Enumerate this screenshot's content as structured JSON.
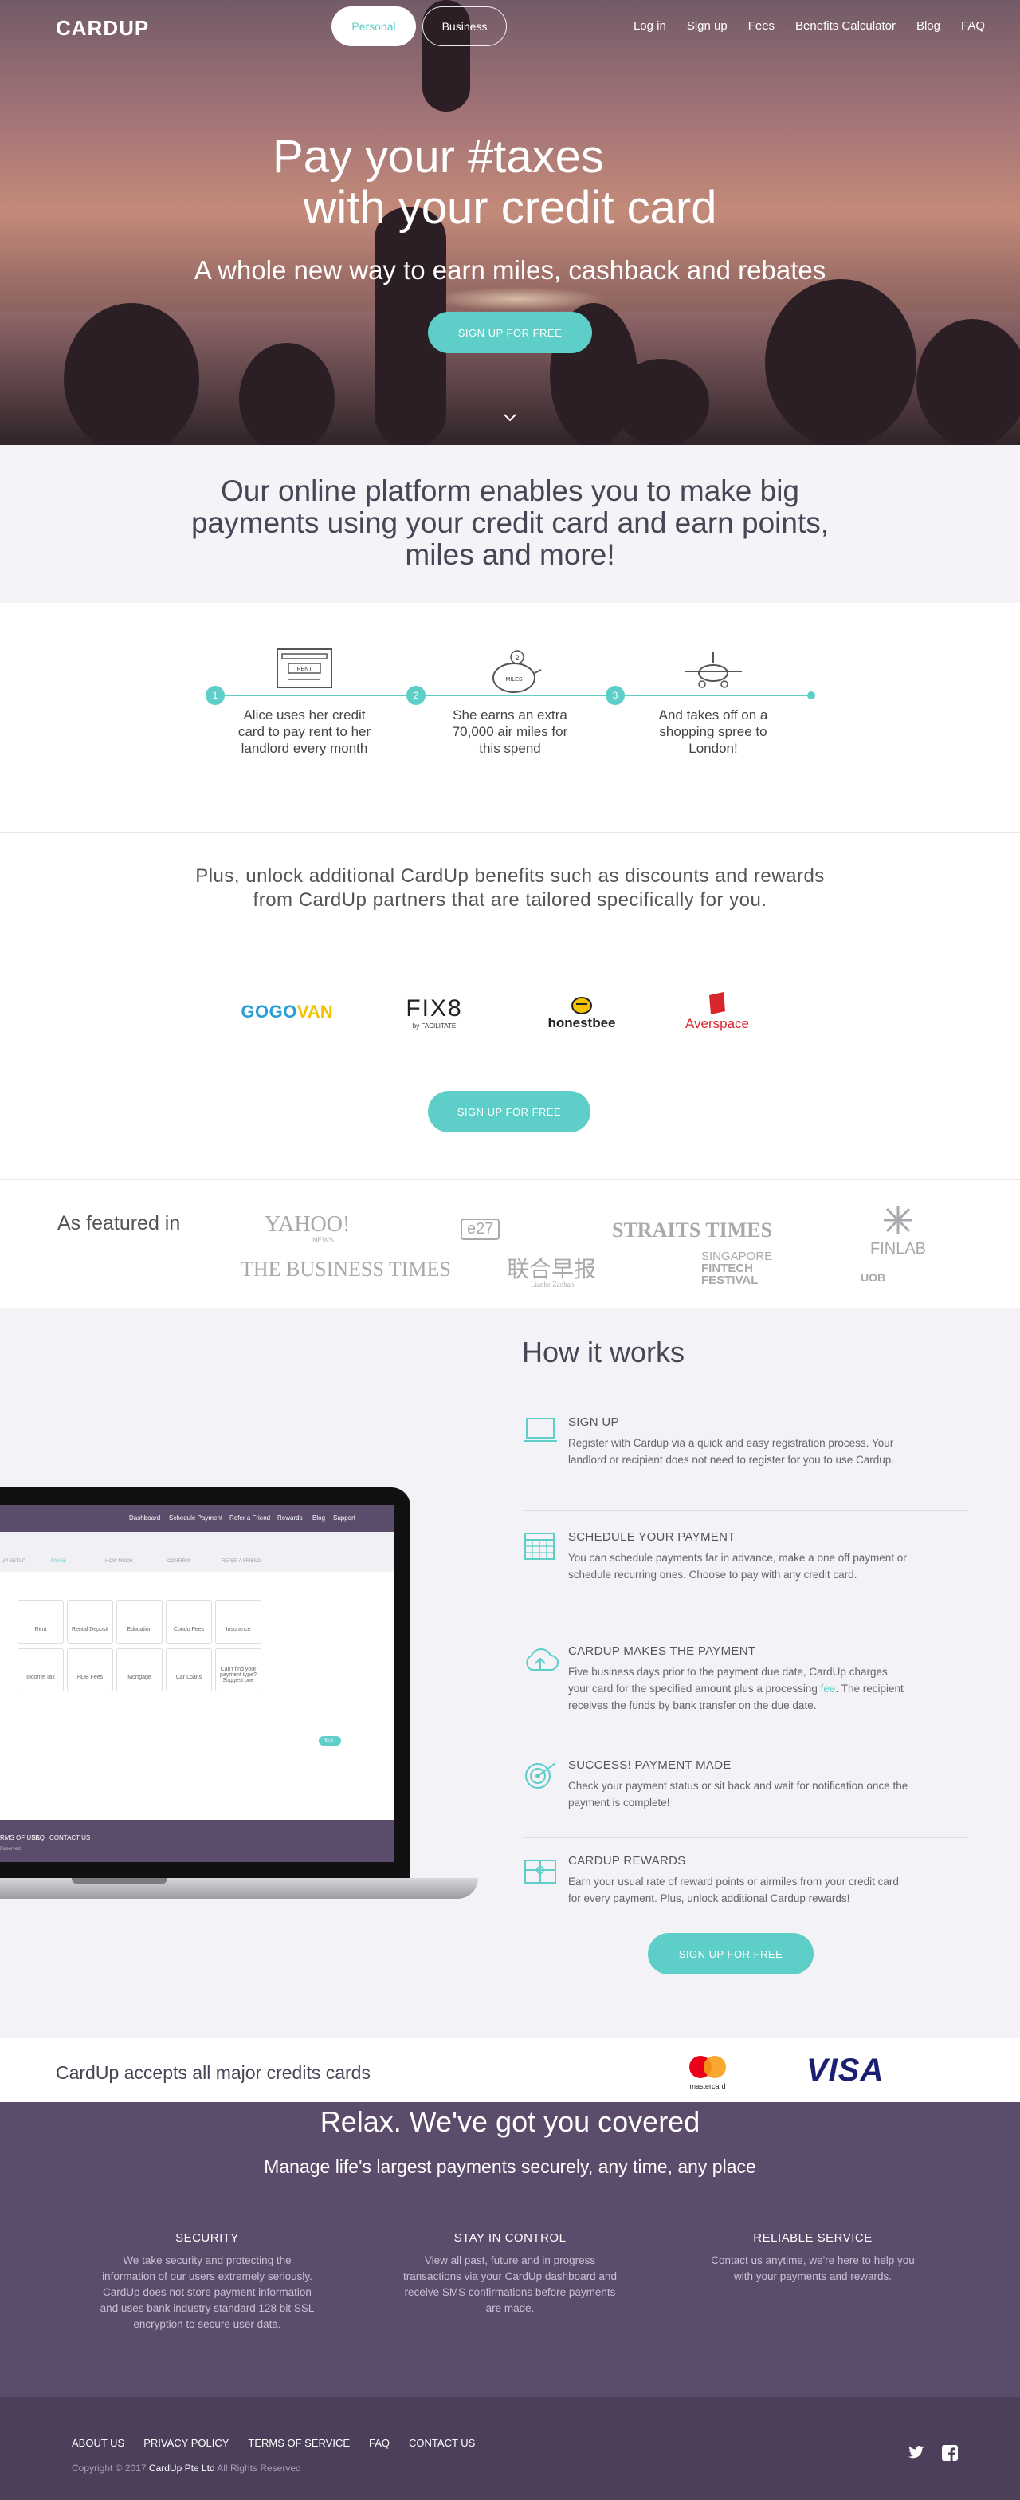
{
  "nav": {
    "logo": "CARDUP",
    "toggle": {
      "personal": "Personal",
      "business": "Business"
    },
    "links": [
      "Log in",
      "Sign up",
      "Fees",
      "Benefits Calculator",
      "Blog",
      "FAQ"
    ]
  },
  "hero": {
    "title_line1": "Pay your #taxes",
    "title_line2": "with your credit card",
    "subtitle": "A whole new way to earn miles, cashback and rebates",
    "cta": "SIGN UP FOR FREE"
  },
  "platform": {
    "text": "Our online platform enables you to make big payments using your credit card and earn points, miles and more!"
  },
  "steps": [
    {
      "num": "1",
      "icon_label": "RENT",
      "text": "Alice uses her credit card to pay rent to her landlord every month"
    },
    {
      "num": "2",
      "icon_label": "MILES",
      "text": "She earns an extra 70,000 air miles for this spend"
    },
    {
      "num": "3",
      "icon_label": "",
      "text": "And takes off on a shopping spree to London!"
    }
  ],
  "partners": {
    "intro": "Plus, unlock additional CardUp benefits such as discounts and rewards from CardUp partners that are tailored specifically for you.",
    "logos": [
      "GOGOVAN",
      "FIX8",
      "honestbee",
      "Averspace"
    ],
    "fix8_sub": "by FACILITATE",
    "cta": "SIGN UP FOR FREE"
  },
  "featured": {
    "label": "As featured in",
    "logos": [
      "YAHOO!",
      "NEWS",
      "e27",
      "STRAITS TIMES",
      "FINLAB",
      "THE BUSINESS TIMES",
      "联合早报",
      "Lianhe Zaobao",
      "SINGAPORE",
      "FINTECH",
      "FESTIVAL",
      "UOB"
    ]
  },
  "how": {
    "title": "How it works",
    "items": [
      {
        "icon": "laptop-icon",
        "title": "SIGN UP",
        "desc": "Register with Cardup via a quick and easy registration process. Your landlord or recipient does not need to register for you to use Cardup."
      },
      {
        "icon": "calendar-icon",
        "title": "SCHEDULE YOUR PAYMENT",
        "desc": "You can schedule payments far in advance, make a one off payment or schedule recurring ones. Choose to pay with any credit card."
      },
      {
        "icon": "cloud-upload-icon",
        "title": "CARDUP MAKES THE PAYMENT",
        "desc_a": "Five business days prior to the payment due date, CardUp charges your card for the specified amount plus a processing ",
        "desc_link": "fee",
        "desc_b": ". The recipient receives the funds by bank transfer on the due date."
      },
      {
        "icon": "target-icon",
        "title": "SUCCESS! PAYMENT MADE",
        "desc": "Check your payment status or sit back and wait for notification once the payment is complete!"
      },
      {
        "icon": "gift-icon",
        "title": "CARDUP REWARDS",
        "desc": "Earn your usual rate of reward points or airmiles from your credit card for every payment. Plus, unlock additional Cardup rewards!"
      }
    ],
    "cta": "SIGN UP FOR FREE",
    "laptop": {
      "nav": [
        "Dashboard",
        "Schedule Payment",
        "Refer a Friend",
        "Rewards",
        "Blog",
        "Support"
      ],
      "steps": [
        "UP SETUP",
        "PAYEE",
        "HOW MUCH",
        "CONFIRM",
        "REFER A FRIEND"
      ],
      "tiles": [
        "Rent",
        "Rental Deposit",
        "Education",
        "Condo Fees",
        "Insurance",
        "Income Tax",
        "HDB Fees",
        "Mortgage",
        "Car Loans",
        "Can't find your payment type? Suggest one"
      ],
      "next": "NEXT",
      "footer": [
        "RMS OF USE",
        "FAQ",
        "CONTACT US"
      ],
      "copyright": "Reserved"
    }
  },
  "cards": {
    "label": "CardUp accepts all major credits cards",
    "mastercard": "mastercard",
    "visa": "VISA"
  },
  "relax": {
    "title": "Relax. We've got you covered",
    "subtitle": "Manage life's largest payments securely, any time, any place",
    "columns": [
      {
        "title": "SECURITY",
        "desc": "We take security and protecting the information of our users extremely seriously. CardUp does not store payment information and uses bank industry standard 128 bit SSL encryption to secure user data."
      },
      {
        "title": "STAY IN CONTROL",
        "desc": "View all past, future and in progress transactions via your CardUp dashboard and receive SMS confirmations before payments are made."
      },
      {
        "title": "RELIABLE SERVICE",
        "desc": "Contact us anytime, we're here to help you with your payments and rewards."
      }
    ]
  },
  "footer": {
    "links": [
      "ABOUT US",
      "PRIVACY POLICY",
      "TERMS OF SERVICE",
      "FAQ",
      "CONTACT US"
    ],
    "copy_pre": "Copyright © 2017",
    "company": "CardUp Pte Ltd",
    "copy_post": "All Rights Reserved"
  },
  "colors": {
    "accent": "#5ecec8",
    "purple": "#5a4c6a",
    "footer": "#4b3f5a"
  }
}
